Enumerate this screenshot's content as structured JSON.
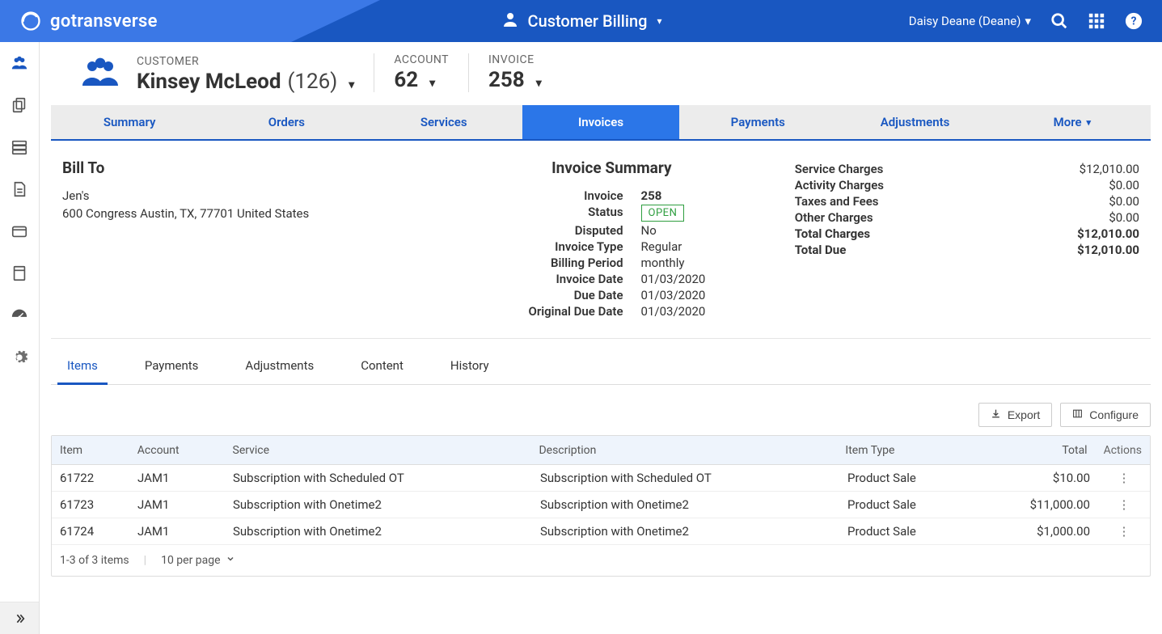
{
  "brand": {
    "name": "gotransverse"
  },
  "header": {
    "app_label": "Customer Billing",
    "user": "Daisy Deane (Deane)"
  },
  "sidebar": {
    "items": [
      {
        "name": "customers-icon",
        "active": true
      },
      {
        "name": "copy-icon"
      },
      {
        "name": "server-icon"
      },
      {
        "name": "document-icon"
      },
      {
        "name": "card-icon"
      },
      {
        "name": "calculator-icon"
      },
      {
        "name": "dashboard-icon"
      },
      {
        "name": "gear-icon"
      }
    ]
  },
  "crumb": {
    "customer": {
      "label": "CUSTOMER",
      "name": "Kinsey McLeod",
      "id": "(126)"
    },
    "account": {
      "label": "ACCOUNT",
      "value": "62"
    },
    "invoice": {
      "label": "INVOICE",
      "value": "258"
    }
  },
  "tabs": [
    {
      "label": "Summary"
    },
    {
      "label": "Orders"
    },
    {
      "label": "Services"
    },
    {
      "label": "Invoices",
      "active": true
    },
    {
      "label": "Payments"
    },
    {
      "label": "Adjustments"
    },
    {
      "label": "More"
    }
  ],
  "billto": {
    "heading": "Bill To",
    "name": "Jen's",
    "address": "600 Congress Austin, TX, 77701 United States"
  },
  "invoice_summary": {
    "heading": "Invoice Summary",
    "fields": {
      "invoice_label": "Invoice",
      "invoice": "258",
      "status_label": "Status",
      "status": "OPEN",
      "disputed_label": "Disputed",
      "disputed": "No",
      "type_label": "Invoice Type",
      "type": "Regular",
      "period_label": "Billing Period",
      "period": "monthly",
      "date_label": "Invoice Date",
      "date": "01/03/2020",
      "due_label": "Due Date",
      "due": "01/03/2020",
      "orig_due_label": "Original Due Date",
      "orig_due": "01/03/2020"
    }
  },
  "charges": {
    "service": {
      "label": "Service Charges",
      "value": "$12,010.00"
    },
    "activity": {
      "label": "Activity Charges",
      "value": "$0.00"
    },
    "taxes": {
      "label": "Taxes and Fees",
      "value": "$0.00"
    },
    "other": {
      "label": "Other Charges",
      "value": "$0.00"
    },
    "total": {
      "label": "Total Charges",
      "value": "$12,010.00"
    },
    "due": {
      "label": "Total Due",
      "value": "$12,010.00"
    }
  },
  "subtabs": [
    {
      "label": "Items",
      "active": true
    },
    {
      "label": "Payments"
    },
    {
      "label": "Adjustments"
    },
    {
      "label": "Content"
    },
    {
      "label": "History"
    }
  ],
  "table_buttons": {
    "export": "Export",
    "configure": "Configure"
  },
  "table": {
    "columns": {
      "item": "Item",
      "account": "Account",
      "service": "Service",
      "description": "Description",
      "type": "Item Type",
      "total": "Total",
      "actions": "Actions"
    },
    "rows": [
      {
        "item": "61722",
        "account": "JAM1",
        "service": "Subscription with Scheduled OT",
        "description": "Subscription with Scheduled OT",
        "type": "Product Sale",
        "total": "$10.00"
      },
      {
        "item": "61723",
        "account": "JAM1",
        "service": "Subscription with Onetime2",
        "description": "Subscription with Onetime2",
        "type": "Product Sale",
        "total": "$11,000.00"
      },
      {
        "item": "61724",
        "account": "JAM1",
        "service": "Subscription with Onetime2",
        "description": "Subscription with Onetime2",
        "type": "Product Sale",
        "total": "$1,000.00"
      }
    ],
    "footer": {
      "count": "1-3 of 3 items",
      "perpage": "10 per page"
    }
  }
}
